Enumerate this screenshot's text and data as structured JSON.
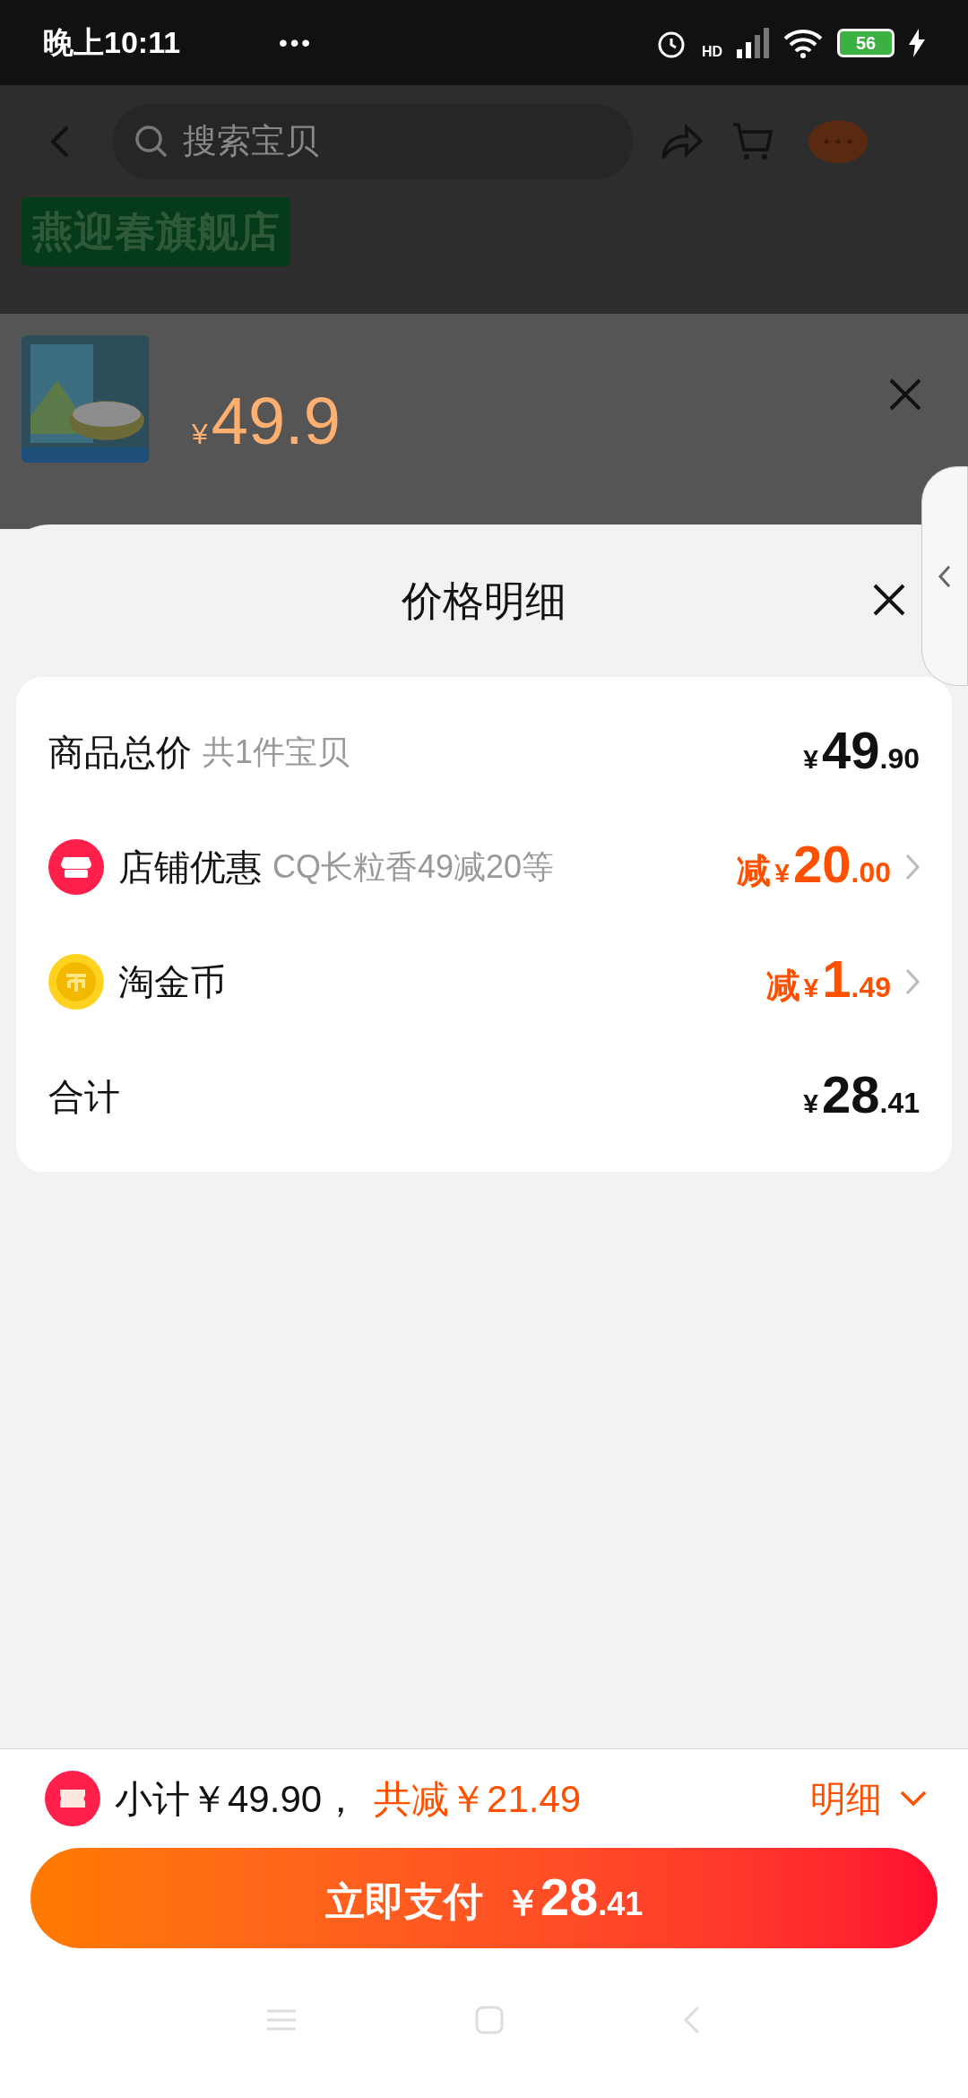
{
  "status_bar": {
    "time": "晚上10:11",
    "more": "•••",
    "network": "HD",
    "battery": "56"
  },
  "background_page": {
    "search_placeholder": "搜索宝贝",
    "store_badge": "燕迎春旗舰店",
    "product_price": {
      "currency": "¥",
      "amount": "49.9"
    }
  },
  "sheet": {
    "title": "价格明细",
    "rows": [
      {
        "kind": "plain",
        "label": "商品总价",
        "note": "共1件宝贝",
        "prefix": "",
        "currency": "¥",
        "integer": "49",
        "decimals": ".90",
        "highlight": false,
        "chevron": false
      },
      {
        "kind": "shop",
        "label": "店铺优惠",
        "note": "CQ长粒香49减20等",
        "prefix": "减",
        "currency": "¥",
        "integer": "20",
        "decimals": ".00",
        "highlight": true,
        "chevron": true
      },
      {
        "kind": "coin",
        "label": "淘金币",
        "note": "",
        "prefix": "减",
        "currency": "¥",
        "integer": "1",
        "decimals": ".49",
        "highlight": true,
        "chevron": true
      },
      {
        "kind": "plain",
        "label": "合计",
        "note": "",
        "prefix": "",
        "currency": "¥",
        "integer": "28",
        "decimals": ".41",
        "highlight": false,
        "chevron": false
      }
    ]
  },
  "footer": {
    "subtotal": "小计￥49.90，",
    "discount": "共减￥21.49",
    "details": "明细",
    "pay_label": "立即支付",
    "pay_currency": "￥",
    "pay_integer": "28",
    "pay_decimals": ".41"
  }
}
